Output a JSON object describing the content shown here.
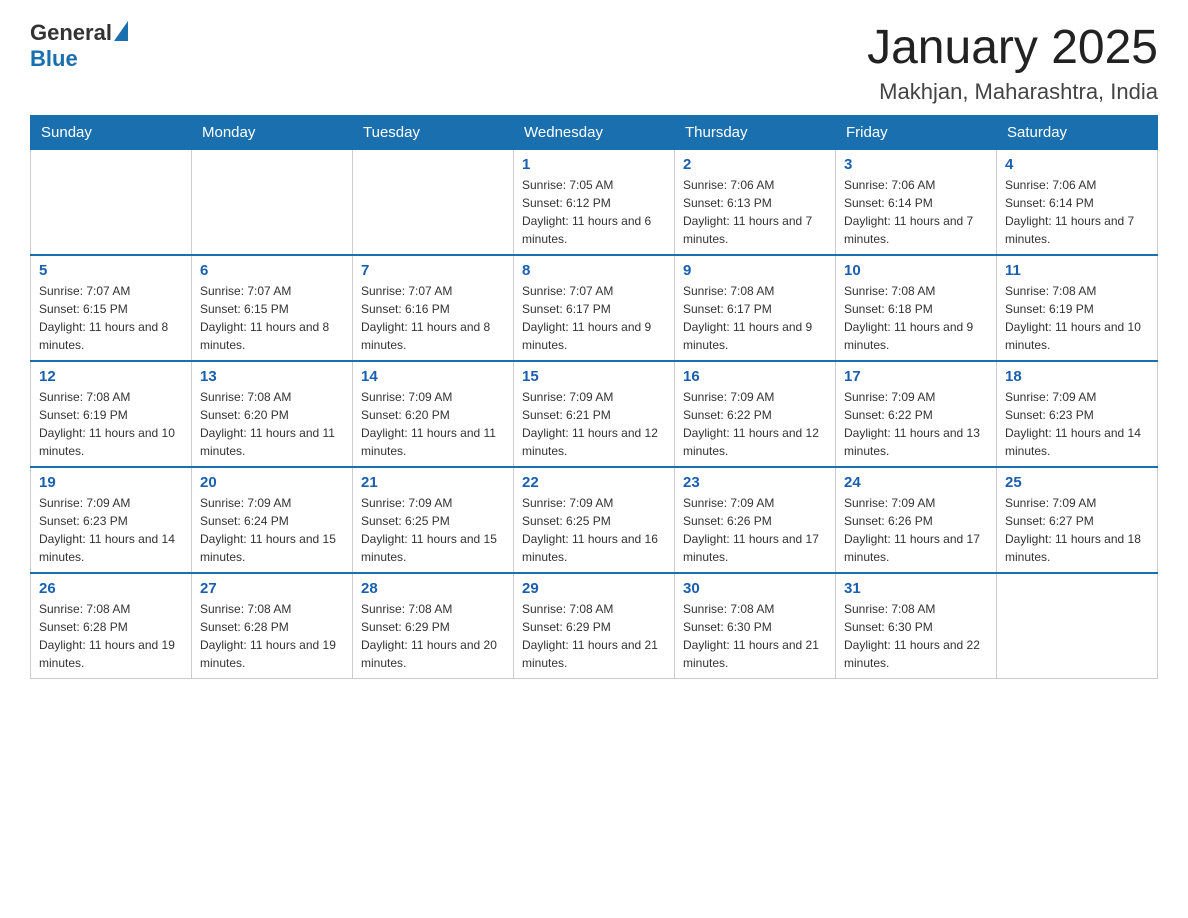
{
  "logo": {
    "text_general": "General",
    "text_blue": "Blue"
  },
  "title": "January 2025",
  "subtitle": "Makhjan, Maharashtra, India",
  "days_of_week": [
    "Sunday",
    "Monday",
    "Tuesday",
    "Wednesday",
    "Thursday",
    "Friday",
    "Saturday"
  ],
  "weeks": [
    [
      {
        "day": "",
        "info": ""
      },
      {
        "day": "",
        "info": ""
      },
      {
        "day": "",
        "info": ""
      },
      {
        "day": "1",
        "info": "Sunrise: 7:05 AM\nSunset: 6:12 PM\nDaylight: 11 hours and 6 minutes."
      },
      {
        "day": "2",
        "info": "Sunrise: 7:06 AM\nSunset: 6:13 PM\nDaylight: 11 hours and 7 minutes."
      },
      {
        "day": "3",
        "info": "Sunrise: 7:06 AM\nSunset: 6:14 PM\nDaylight: 11 hours and 7 minutes."
      },
      {
        "day": "4",
        "info": "Sunrise: 7:06 AM\nSunset: 6:14 PM\nDaylight: 11 hours and 7 minutes."
      }
    ],
    [
      {
        "day": "5",
        "info": "Sunrise: 7:07 AM\nSunset: 6:15 PM\nDaylight: 11 hours and 8 minutes."
      },
      {
        "day": "6",
        "info": "Sunrise: 7:07 AM\nSunset: 6:15 PM\nDaylight: 11 hours and 8 minutes."
      },
      {
        "day": "7",
        "info": "Sunrise: 7:07 AM\nSunset: 6:16 PM\nDaylight: 11 hours and 8 minutes."
      },
      {
        "day": "8",
        "info": "Sunrise: 7:07 AM\nSunset: 6:17 PM\nDaylight: 11 hours and 9 minutes."
      },
      {
        "day": "9",
        "info": "Sunrise: 7:08 AM\nSunset: 6:17 PM\nDaylight: 11 hours and 9 minutes."
      },
      {
        "day": "10",
        "info": "Sunrise: 7:08 AM\nSunset: 6:18 PM\nDaylight: 11 hours and 9 minutes."
      },
      {
        "day": "11",
        "info": "Sunrise: 7:08 AM\nSunset: 6:19 PM\nDaylight: 11 hours and 10 minutes."
      }
    ],
    [
      {
        "day": "12",
        "info": "Sunrise: 7:08 AM\nSunset: 6:19 PM\nDaylight: 11 hours and 10 minutes."
      },
      {
        "day": "13",
        "info": "Sunrise: 7:08 AM\nSunset: 6:20 PM\nDaylight: 11 hours and 11 minutes."
      },
      {
        "day": "14",
        "info": "Sunrise: 7:09 AM\nSunset: 6:20 PM\nDaylight: 11 hours and 11 minutes."
      },
      {
        "day": "15",
        "info": "Sunrise: 7:09 AM\nSunset: 6:21 PM\nDaylight: 11 hours and 12 minutes."
      },
      {
        "day": "16",
        "info": "Sunrise: 7:09 AM\nSunset: 6:22 PM\nDaylight: 11 hours and 12 minutes."
      },
      {
        "day": "17",
        "info": "Sunrise: 7:09 AM\nSunset: 6:22 PM\nDaylight: 11 hours and 13 minutes."
      },
      {
        "day": "18",
        "info": "Sunrise: 7:09 AM\nSunset: 6:23 PM\nDaylight: 11 hours and 14 minutes."
      }
    ],
    [
      {
        "day": "19",
        "info": "Sunrise: 7:09 AM\nSunset: 6:23 PM\nDaylight: 11 hours and 14 minutes."
      },
      {
        "day": "20",
        "info": "Sunrise: 7:09 AM\nSunset: 6:24 PM\nDaylight: 11 hours and 15 minutes."
      },
      {
        "day": "21",
        "info": "Sunrise: 7:09 AM\nSunset: 6:25 PM\nDaylight: 11 hours and 15 minutes."
      },
      {
        "day": "22",
        "info": "Sunrise: 7:09 AM\nSunset: 6:25 PM\nDaylight: 11 hours and 16 minutes."
      },
      {
        "day": "23",
        "info": "Sunrise: 7:09 AM\nSunset: 6:26 PM\nDaylight: 11 hours and 17 minutes."
      },
      {
        "day": "24",
        "info": "Sunrise: 7:09 AM\nSunset: 6:26 PM\nDaylight: 11 hours and 17 minutes."
      },
      {
        "day": "25",
        "info": "Sunrise: 7:09 AM\nSunset: 6:27 PM\nDaylight: 11 hours and 18 minutes."
      }
    ],
    [
      {
        "day": "26",
        "info": "Sunrise: 7:08 AM\nSunset: 6:28 PM\nDaylight: 11 hours and 19 minutes."
      },
      {
        "day": "27",
        "info": "Sunrise: 7:08 AM\nSunset: 6:28 PM\nDaylight: 11 hours and 19 minutes."
      },
      {
        "day": "28",
        "info": "Sunrise: 7:08 AM\nSunset: 6:29 PM\nDaylight: 11 hours and 20 minutes."
      },
      {
        "day": "29",
        "info": "Sunrise: 7:08 AM\nSunset: 6:29 PM\nDaylight: 11 hours and 21 minutes."
      },
      {
        "day": "30",
        "info": "Sunrise: 7:08 AM\nSunset: 6:30 PM\nDaylight: 11 hours and 21 minutes."
      },
      {
        "day": "31",
        "info": "Sunrise: 7:08 AM\nSunset: 6:30 PM\nDaylight: 11 hours and 22 minutes."
      },
      {
        "day": "",
        "info": ""
      }
    ]
  ]
}
